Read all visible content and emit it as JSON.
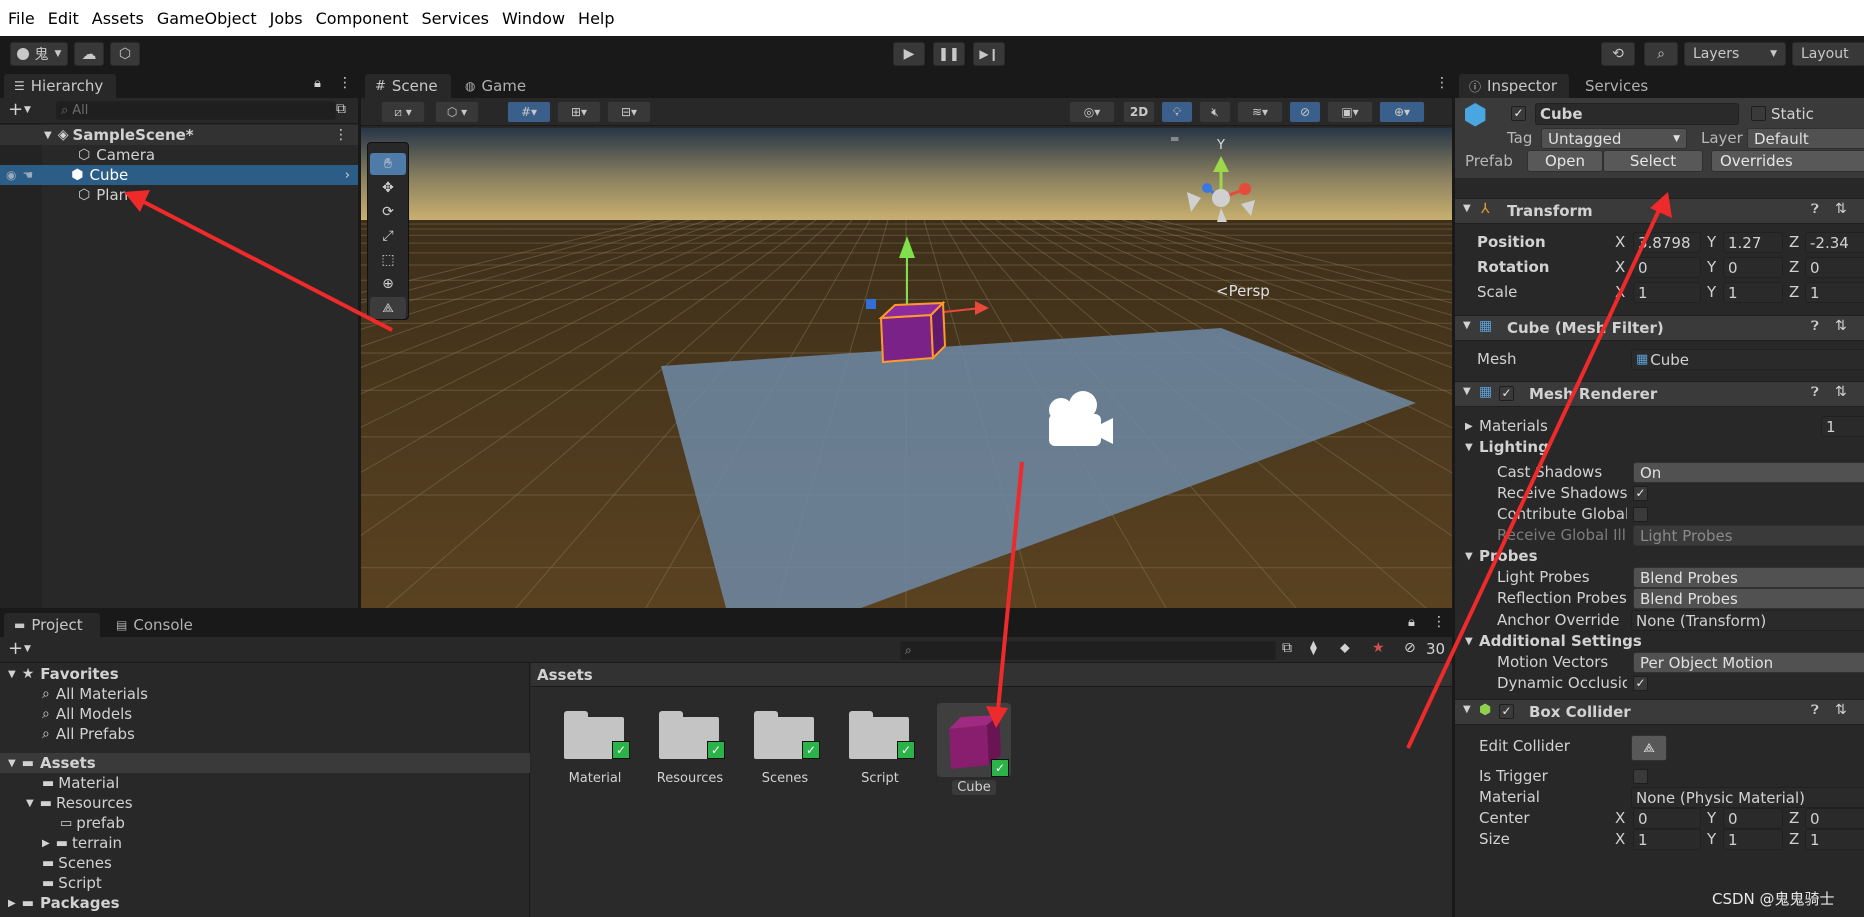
{
  "menu": [
    "File",
    "Edit",
    "Assets",
    "GameObject",
    "Jobs",
    "Component",
    "Services",
    "Window",
    "Help"
  ],
  "toolbar": {
    "account_label": "鬼",
    "layers": "Layers",
    "layout": "Layout"
  },
  "hierarchy": {
    "tab": "Hierarchy",
    "search_placeholder": "All",
    "scene": "SampleScene*",
    "items": [
      "Camera",
      "Cube",
      "Plane"
    ]
  },
  "scene_view": {
    "tabs": [
      "Scene",
      "Game"
    ],
    "mode_2d": "2D",
    "persp": "<Persp"
  },
  "project": {
    "tabs": [
      "Project",
      "Console"
    ],
    "hidden_count": "30",
    "favorites_label": "Favorites",
    "favorites": [
      "All Materials",
      "All Models",
      "All Prefabs"
    ],
    "assets_label": "Assets",
    "tree": [
      {
        "label": "Material",
        "indent": 1
      },
      {
        "label": "Resources",
        "indent": 1
      },
      {
        "label": "prefab",
        "indent": 2
      },
      {
        "label": "terrain",
        "indent": 2
      },
      {
        "label": "Scenes",
        "indent": 1
      },
      {
        "label": "Script",
        "indent": 1
      }
    ],
    "packages_label": "Packages",
    "breadcrumb": "Assets",
    "grid_items": [
      "Material",
      "Resources",
      "Scenes",
      "Script",
      "Cube"
    ]
  },
  "inspector": {
    "tabs": [
      "Inspector",
      "Services"
    ],
    "object_name": "Cube",
    "static_label": "Static",
    "tag_label": "Tag",
    "tag_value": "Untagged",
    "layer_label": "Layer",
    "layer_value": "Default",
    "prefab_label": "Prefab",
    "prefab_open": "Open",
    "prefab_select": "Select",
    "prefab_overrides": "Overrides",
    "transform": {
      "title": "Transform",
      "position_label": "Position",
      "position": {
        "x": "3.8798",
        "y": "1.27",
        "z": "-2.34"
      },
      "rotation_label": "Rotation",
      "rotation": {
        "x": "0",
        "y": "0",
        "z": "0"
      },
      "scale_label": "Scale",
      "scale": {
        "x": "1",
        "y": "1",
        "z": "1"
      }
    },
    "mesh_filter": {
      "title": "Cube (Mesh Filter)",
      "mesh_label": "Mesh",
      "mesh_value": "Cube"
    },
    "mesh_renderer": {
      "title": "Mesh Renderer",
      "materials_label": "Materials",
      "materials_count": "1",
      "lighting_label": "Lighting",
      "cast_shadows_label": "Cast Shadows",
      "cast_shadows": "On",
      "receive_shadows_label": "Receive Shadows",
      "contribute_gi_label": "Contribute Global I",
      "receive_gi_label": "Receive Global Illu",
      "receive_gi": "Light Probes",
      "probes_label": "Probes",
      "light_probes_label": "Light Probes",
      "light_probes": "Blend Probes",
      "reflection_probes_label": "Reflection Probes",
      "reflection_probes": "Blend Probes",
      "anchor_override_label": "Anchor Override",
      "anchor_override": "None (Transform)",
      "additional_label": "Additional Settings",
      "motion_vectors_label": "Motion Vectors",
      "motion_vectors": "Per Object Motion",
      "dynamic_occlusion_label": "Dynamic Occlusio"
    },
    "box_collider": {
      "title": "Box Collider",
      "edit_collider_label": "Edit Collider",
      "is_trigger_label": "Is Trigger",
      "material_label": "Material",
      "material_value": "None (Physic Material)",
      "center_label": "Center",
      "center": {
        "x": "0",
        "y": "0",
        "z": "0"
      },
      "size_label": "Size",
      "size": {
        "x": "1",
        "y": "1",
        "z": "1"
      }
    }
  },
  "axis_letters": {
    "x": "X",
    "y": "Y",
    "z": "Z"
  },
  "watermark": "CSDN @鬼鬼骑士"
}
